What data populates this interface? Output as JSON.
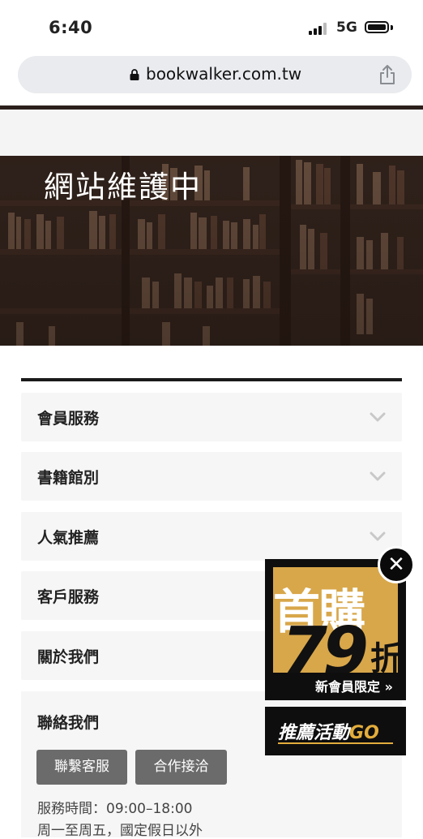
{
  "status_bar": {
    "time": "6:40",
    "network": "5G"
  },
  "browser": {
    "url": "bookwalker.com.tw"
  },
  "hero": {
    "title": "網站維護中"
  },
  "accordion": [
    {
      "label": "會員服務"
    },
    {
      "label": "書籍館別"
    },
    {
      "label": "人氣推薦"
    },
    {
      "label": "客戶服務"
    },
    {
      "label": "關於我們"
    }
  ],
  "contact": {
    "title": "聯絡我們",
    "buttons": [
      "聯繫客服",
      "合作接洽"
    ],
    "hours": "服務時間：09:00–18:00",
    "days": "周一至周五，國定假日以外"
  },
  "promo": {
    "headline": "首購",
    "discount_number": "79",
    "discount_unit": "折",
    "tagline": "新會員限定 »",
    "event_label": "推薦活動",
    "event_go": "GO",
    "colors": {
      "gold": "#d8a74a",
      "go": "#e3ad3c",
      "dark": "#0e0e0e"
    }
  }
}
